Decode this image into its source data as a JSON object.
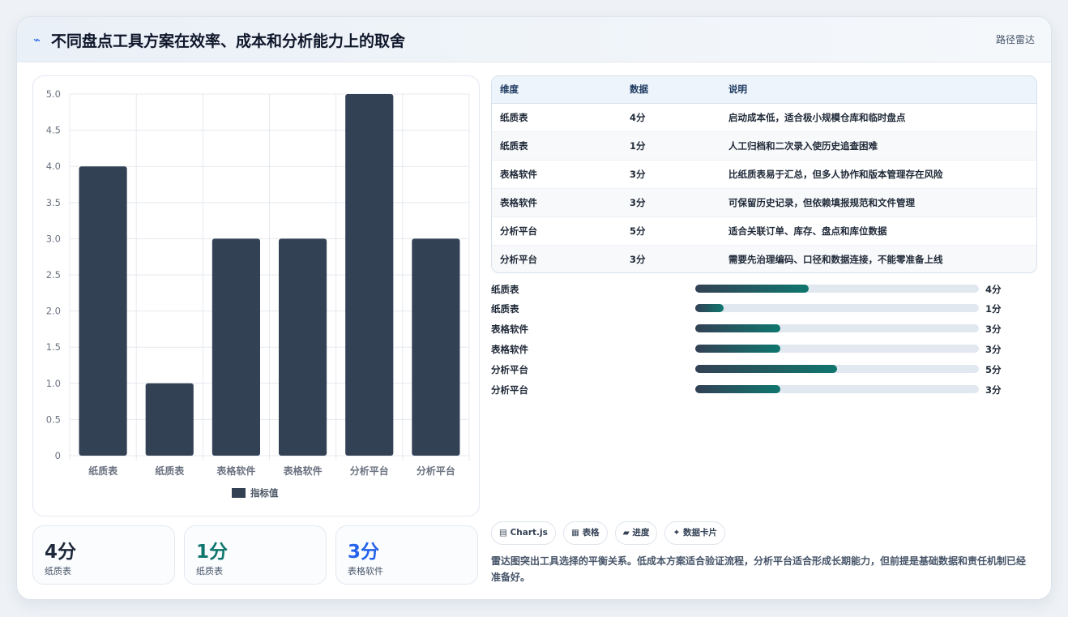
{
  "header": {
    "icon": "lightning-icon",
    "title": "不同盘点工具方案在效率、成本和分析能力上的取舍",
    "tag": "路径雷达"
  },
  "chart_data": {
    "type": "bar",
    "categories": [
      "纸质表",
      "纸质表",
      "表格软件",
      "表格软件",
      "分析平台",
      "分析平台"
    ],
    "series": [
      {
        "name": "指标值",
        "values": [
          4,
          1,
          3,
          3,
          5,
          3
        ],
        "color": "#334155"
      }
    ],
    "ylim": [
      0,
      5
    ],
    "yticks": [
      "0",
      "0.5",
      "1.0",
      "1.5",
      "2.0",
      "2.5",
      "3.0",
      "3.5",
      "4.0",
      "4.5",
      "5.0"
    ],
    "grid": true,
    "legend": "bottom"
  },
  "kpis": [
    {
      "value": "4分",
      "label": "纸质表",
      "color": "#1e293b"
    },
    {
      "value": "1分",
      "label": "纸质表",
      "color": "#0f766e"
    },
    {
      "value": "3分",
      "label": "表格软件",
      "color": "#2563eb"
    }
  ],
  "table": {
    "headers": [
      "维度",
      "数据",
      "说明"
    ],
    "rows": [
      [
        "纸质表",
        "4分",
        "启动成本低，适合极小规模仓库和临时盘点"
      ],
      [
        "纸质表",
        "1分",
        "人工归档和二次录入使历史追查困难"
      ],
      [
        "表格软件",
        "3分",
        "比纸质表易于汇总，但多人协作和版本管理存在风险"
      ],
      [
        "表格软件",
        "3分",
        "可保留历史记录，但依赖填报规范和文件管理"
      ],
      [
        "分析平台",
        "5分",
        "适合关联订单、库存、盘点和库位数据"
      ],
      [
        "分析平台",
        "3分",
        "需要先治理编码、口径和数据连接，不能零准备上线"
      ]
    ]
  },
  "progress": {
    "max": 10,
    "items": [
      {
        "label": "纸质表",
        "value": 4,
        "text": "4分"
      },
      {
        "label": "纸质表",
        "value": 1,
        "text": "1分"
      },
      {
        "label": "表格软件",
        "value": 3,
        "text": "3分"
      },
      {
        "label": "表格软件",
        "value": 3,
        "text": "3分"
      },
      {
        "label": "分析平台",
        "value": 5,
        "text": "5分"
      },
      {
        "label": "分析平台",
        "value": 3,
        "text": "3分"
      }
    ]
  },
  "chips": [
    {
      "icon": "chart-icon",
      "glyph": "▤",
      "label": "Chart.js"
    },
    {
      "icon": "table-icon",
      "glyph": "▦",
      "label": "表格"
    },
    {
      "icon": "progress-icon",
      "glyph": "▰",
      "label": "进度"
    },
    {
      "icon": "sparkle-icon",
      "glyph": "✦",
      "label": "数据卡片"
    }
  ],
  "note": "雷达图突出工具选择的平衡关系。低成本方案适合验证流程，分析平台适合形成长期能力，但前提是基础数据和责任机制已经准备好。"
}
